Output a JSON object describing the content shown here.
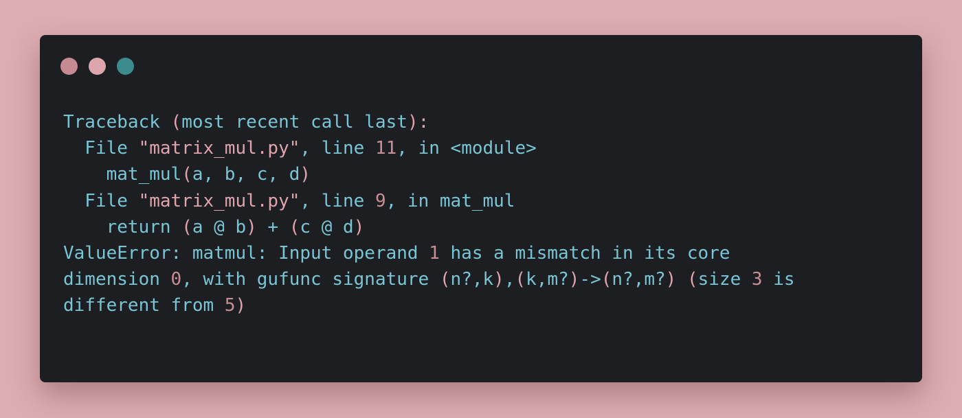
{
  "window": {
    "dots": [
      {
        "name": "close-dot",
        "color": "#c88a91"
      },
      {
        "name": "minimize-dot",
        "color": "#dca6ac"
      },
      {
        "name": "maximize-dot",
        "color": "#3c8c8d"
      }
    ]
  },
  "colors": {
    "background": "#dcadb1",
    "window": "#1c1e22",
    "text": "#79c5d4",
    "string": "#e0a4ad",
    "number": "#c98e94"
  },
  "code": {
    "lines": [
      [
        {
          "t": "Traceback ",
          "k": "plain"
        },
        {
          "t": "(",
          "k": "paren"
        },
        {
          "t": "most recent call last",
          "k": "plain"
        },
        {
          "t": "):",
          "k": "paren"
        }
      ],
      [
        {
          "t": "  File ",
          "k": "plain"
        },
        {
          "t": "\"matrix_mul.py\"",
          "k": "string"
        },
        {
          "t": ", line ",
          "k": "plain"
        },
        {
          "t": "11",
          "k": "number"
        },
        {
          "t": ", in <module>",
          "k": "plain"
        }
      ],
      [
        {
          "t": "    mat_mul",
          "k": "plain"
        },
        {
          "t": "(",
          "k": "paren"
        },
        {
          "t": "a, b, c, d",
          "k": "plain"
        },
        {
          "t": ")",
          "k": "paren"
        }
      ],
      [
        {
          "t": "  File ",
          "k": "plain"
        },
        {
          "t": "\"matrix_mul.py\"",
          "k": "string"
        },
        {
          "t": ", line ",
          "k": "plain"
        },
        {
          "t": "9",
          "k": "number"
        },
        {
          "t": ", in mat_mul",
          "k": "plain"
        }
      ],
      [
        {
          "t": "    return ",
          "k": "plain"
        },
        {
          "t": "(",
          "k": "paren"
        },
        {
          "t": "a @ b",
          "k": "plain"
        },
        {
          "t": ")",
          "k": "paren"
        },
        {
          "t": " + ",
          "k": "plain"
        },
        {
          "t": "(",
          "k": "paren"
        },
        {
          "t": "c @ d",
          "k": "plain"
        },
        {
          "t": ")",
          "k": "paren"
        }
      ],
      [
        {
          "t": "ValueError: matmul: Input operand ",
          "k": "plain"
        },
        {
          "t": "1",
          "k": "number"
        },
        {
          "t": " has a mismatch in its core",
          "k": "plain"
        }
      ],
      [
        {
          "t": "dimension ",
          "k": "plain"
        },
        {
          "t": "0",
          "k": "number"
        },
        {
          "t": ", with gufunc signature ",
          "k": "plain"
        },
        {
          "t": "(",
          "k": "paren"
        },
        {
          "t": "n?,k",
          "k": "plain"
        },
        {
          "t": ")",
          "k": "paren"
        },
        {
          "t": ",",
          "k": "plain"
        },
        {
          "t": "(",
          "k": "paren"
        },
        {
          "t": "k,m?",
          "k": "plain"
        },
        {
          "t": ")",
          "k": "paren"
        },
        {
          "t": "->",
          "k": "plain"
        },
        {
          "t": "(",
          "k": "paren"
        },
        {
          "t": "n?,m?",
          "k": "plain"
        },
        {
          "t": ")",
          "k": "paren"
        },
        {
          "t": " ",
          "k": "plain"
        },
        {
          "t": "(",
          "k": "paren"
        },
        {
          "t": "size ",
          "k": "plain"
        },
        {
          "t": "3",
          "k": "number"
        },
        {
          "t": " is",
          "k": "plain"
        }
      ],
      [
        {
          "t": "different from ",
          "k": "plain"
        },
        {
          "t": "5",
          "k": "number"
        },
        {
          "t": ")",
          "k": "paren"
        }
      ]
    ]
  }
}
